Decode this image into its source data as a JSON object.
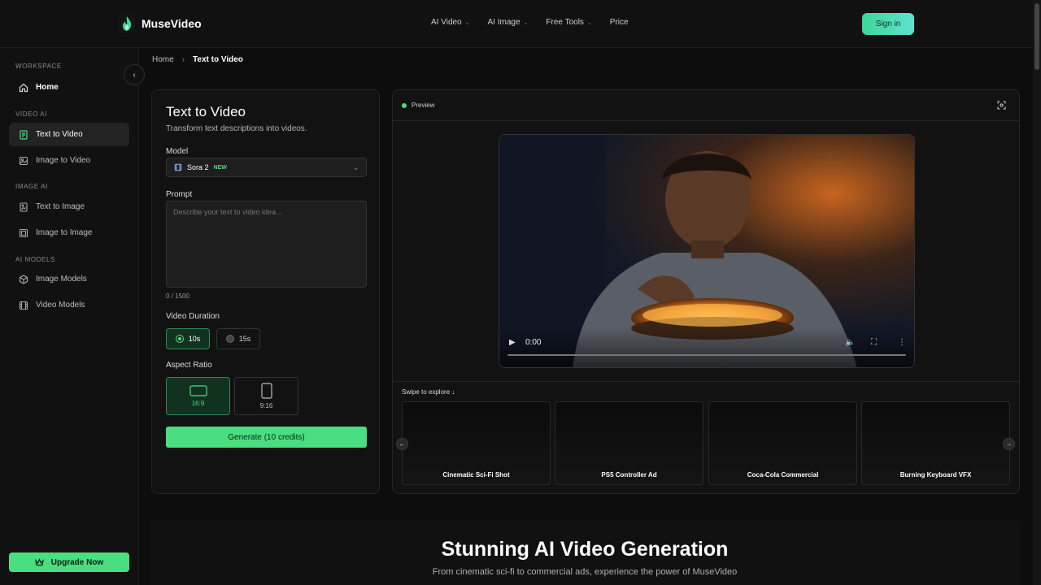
{
  "brand": {
    "name": "MuseVideo"
  },
  "nav": {
    "items": [
      {
        "label": "AI Video",
        "has_menu": true
      },
      {
        "label": "AI Image",
        "has_menu": true
      },
      {
        "label": "Free Tools",
        "has_menu": true
      },
      {
        "label": "Price",
        "has_menu": false
      }
    ],
    "signin_label": "Sign in"
  },
  "sidebar": {
    "sections": [
      {
        "heading": "WORKSPACE",
        "items": [
          {
            "label": "Home",
            "icon": "home-icon"
          }
        ]
      },
      {
        "heading": "VIDEO AI",
        "items": [
          {
            "label": "Text to Video",
            "icon": "file-text-icon",
            "active": true
          },
          {
            "label": "Image to Video",
            "icon": "image-icon"
          }
        ]
      },
      {
        "heading": "IMAGE AI",
        "items": [
          {
            "label": "Text to Image",
            "icon": "file-image-icon"
          },
          {
            "label": "Image to Image",
            "icon": "images-icon"
          }
        ]
      },
      {
        "heading": "AI MODELS",
        "items": [
          {
            "label": "Image Models",
            "icon": "cube-icon"
          },
          {
            "label": "Video Models",
            "icon": "film-icon"
          }
        ]
      }
    ],
    "upgrade_label": "Upgrade Now"
  },
  "breadcrumb": {
    "home": "Home",
    "current": "Text to Video"
  },
  "form": {
    "title": "Text to Video",
    "subtitle": "Transform text descriptions into videos.",
    "model_label": "Model",
    "model_value": "Sora 2",
    "model_badge": "NEW",
    "prompt_label": "Prompt",
    "prompt_placeholder": "Describe your text to video idea...",
    "char_count": "0 / 1500",
    "duration_label": "Video Duration",
    "durations": [
      {
        "label": "10s",
        "selected": true
      },
      {
        "label": "15s",
        "selected": false
      }
    ],
    "aspect_label": "Aspect Ratio",
    "aspects": [
      {
        "label": "16:9",
        "selected": true
      },
      {
        "label": "9:16",
        "selected": false
      }
    ],
    "generate_label": "Generate (10 credits)"
  },
  "preview": {
    "label": "Preview",
    "video_time": "0:00",
    "explore_label": "Swipe to explore ↓",
    "examples": [
      "Cinematic Sci-Fi Shot",
      "PS5 Controller Ad",
      "Coca-Cola Commercial",
      "Burning Keyboard VFX"
    ]
  },
  "hero": {
    "title": "Stunning AI Video Generation",
    "subtitle": "From cinematic sci-fi to commercial ads, experience the power of MuseVideo"
  },
  "colors": {
    "accent": "#4ade80",
    "background": "#0d0d0d",
    "panel": "#121212"
  }
}
